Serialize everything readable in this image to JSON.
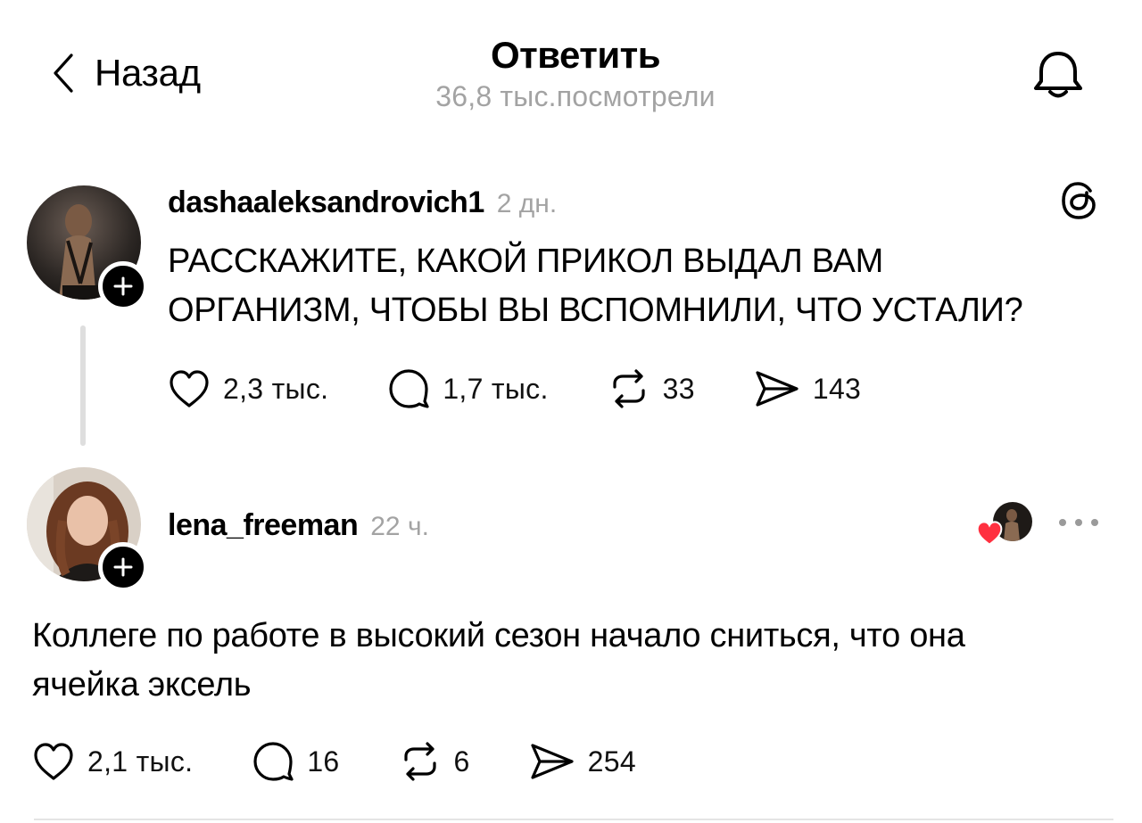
{
  "header": {
    "back_label": "Назад",
    "title": "Ответить",
    "subtitle": "36,8 тыс.посмотрели"
  },
  "post": {
    "username": "dashaaleksandrovich1",
    "time": "2 дн.",
    "text_line1": "РАССКАЖИТЕ, КАКОЙ ПРИКОЛ ВЫДАЛ ВАМ",
    "text_line2": "ОРГАНИЗМ, ЧТОБЫ ВЫ ВСПОМНИЛИ, ЧТО УСТАЛИ?",
    "likes": "2,3 тыс.",
    "replies": "1,7 тыс.",
    "reposts": "33",
    "shares": "143"
  },
  "reply": {
    "username": "lena_freeman",
    "time": "22 ч.",
    "text_line1": "Коллеге по работе в высокий сезон начало сниться, что она",
    "text_line2": "ячейка эксель",
    "likes": "2,1 тыс.",
    "replies": "16",
    "reposts": "6",
    "shares": "254"
  },
  "colors": {
    "muted": "#a3a3a3",
    "heart": "#ff3040",
    "thread_line": "#dedede"
  },
  "icons": [
    "chevron-left-icon",
    "bell-icon",
    "threads-logo-icon",
    "heart-icon",
    "comment-icon",
    "repost-icon",
    "share-icon",
    "more-icon",
    "plus-icon"
  ]
}
